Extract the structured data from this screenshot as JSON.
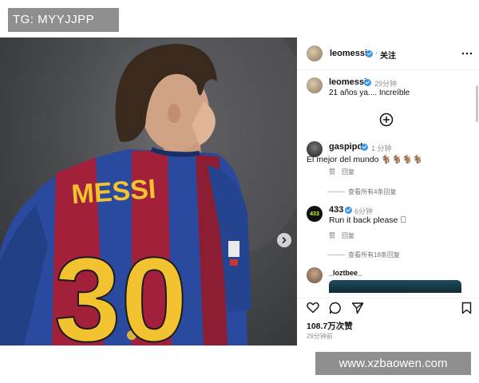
{
  "watermarks": {
    "top": "TG: MYYJJPP",
    "bottom": "www.xzbaowen.com"
  },
  "post": {
    "author": "leomessi",
    "follow_label": "关注",
    "jersey_name": "MESSI",
    "jersey_number": "30",
    "caption": {
      "username": "leomessi",
      "time": "29分钟",
      "text": "21 años ya.... Increíble"
    },
    "comments": [
      {
        "username": "gaspipd",
        "time": "1 分钟",
        "text": "El mejor del mundo 🐐🐐🐐🐐",
        "like_label": "赞",
        "reply_label": "回复",
        "view_replies": "查看所有4条回复"
      },
      {
        "username": "433",
        "avatar_text": "433",
        "time": "6分钟",
        "text": "Run it back please ⃞",
        "like_label": "赞",
        "reply_label": "回复",
        "view_replies": "查看所有18条回复"
      },
      {
        "username": "_loztbee_"
      }
    ],
    "likes": "108.7万次赞",
    "posted": "29分钟前"
  },
  "icons": [
    "more-icon",
    "add-comment-icon",
    "heart-icon",
    "comment-icon",
    "share-icon",
    "bookmark-icon",
    "chevron-right-icon",
    "verified-icon"
  ],
  "colors": {
    "verified": "#3897f0",
    "jersey_blue": "#2a4aa0",
    "jersey_red": "#a3203a",
    "jersey_yellow": "#f2c230",
    "watermark_bg": "#8f8f8f"
  }
}
